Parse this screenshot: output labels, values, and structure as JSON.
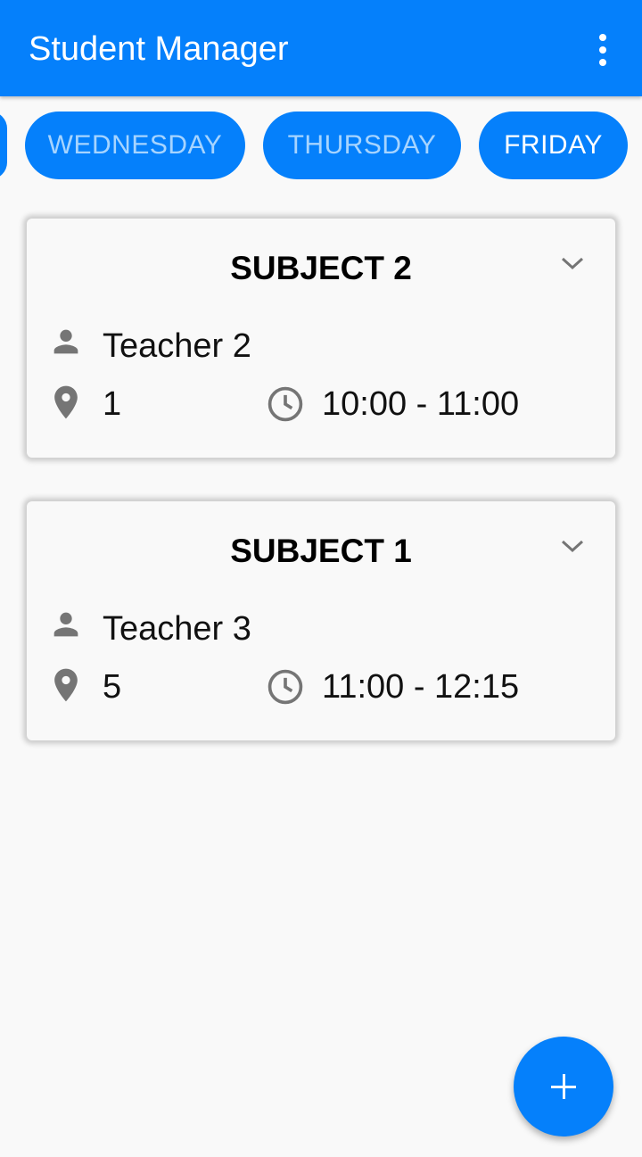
{
  "appbar": {
    "title": "Student Manager",
    "menu_icon": "more-vert-icon"
  },
  "days": [
    {
      "label": "WEDNESDAY",
      "selected": false
    },
    {
      "label": "THURSDAY",
      "selected": false
    },
    {
      "label": "FRIDAY",
      "selected": true
    }
  ],
  "classes": [
    {
      "subject": "SUBJECT 2",
      "teacher": "Teacher 2",
      "room": "1",
      "time": "10:00 - 11:00"
    },
    {
      "subject": "SUBJECT 1",
      "teacher": "Teacher 3",
      "room": "5",
      "time": "11:00 - 12:15"
    }
  ],
  "icons": {
    "teacher": "person-icon",
    "room": "location-pin-icon",
    "time": "clock-icon",
    "expand": "chevron-down-icon",
    "add": "plus-icon"
  },
  "colors": {
    "primary": "#0580fb",
    "chip_unselected_text": "#a6d4ff",
    "chip_selected_text": "#ffffff",
    "icon_gray": "#757575"
  }
}
